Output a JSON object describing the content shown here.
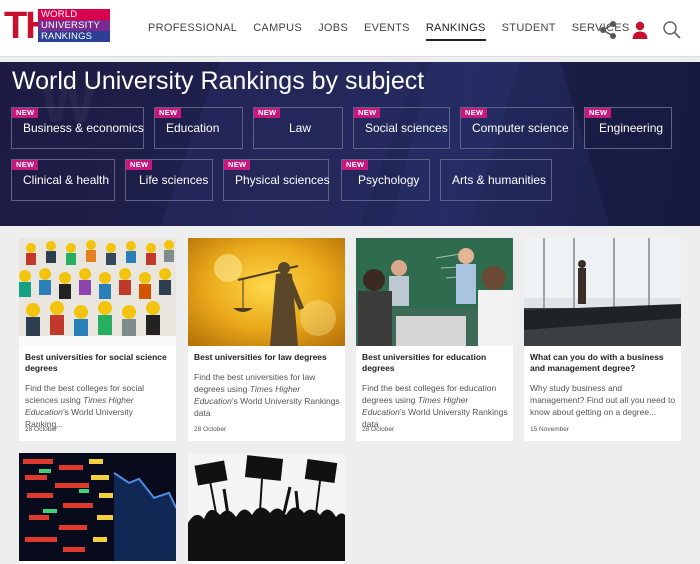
{
  "header": {
    "logo": {
      "big": "THE",
      "line1": "WORLD",
      "line2": "UNIVERSITY",
      "line3": "RANKINGS"
    },
    "nav": [
      "PROFESSIONAL",
      "CAMPUS",
      "JOBS",
      "EVENTS",
      "RANKINGS",
      "STUDENT",
      "SERVICES"
    ],
    "active_nav": "RANKINGS",
    "icons": [
      "share-icon",
      "user-icon",
      "search-icon"
    ]
  },
  "banner": {
    "title": "World University Rankings by subject",
    "badge": "NEW",
    "subjects": [
      {
        "label": "Business & economics",
        "new": true
      },
      {
        "label": "Education",
        "new": true
      },
      {
        "label": "Law",
        "new": true
      },
      {
        "label": "Social sciences",
        "new": true
      },
      {
        "label": "Computer science",
        "new": true
      },
      {
        "label": "Engineering",
        "new": true
      },
      {
        "label": "Clinical & health",
        "new": true
      },
      {
        "label": "Life sciences",
        "new": true
      },
      {
        "label": "Physical sciences",
        "new": true
      },
      {
        "label": "Psychology",
        "new": true
      },
      {
        "label": "Arts & humanities",
        "new": false
      }
    ]
  },
  "cards": [
    {
      "title": "Best universities for social science degrees",
      "desc_pre": "Find the best colleges for social sciences using ",
      "desc_em": "Times Higher Education",
      "desc_post": "’s World University Ranking...",
      "date": "28 October",
      "image": "lego-figures-image"
    },
    {
      "title": "Best universities for law degrees",
      "desc_pre": "Find the best universities for law degrees using ",
      "desc_em": "Times Higher Education",
      "desc_post": "’s World University Rankings data",
      "date": "28 October",
      "image": "lady-justice-image"
    },
    {
      "title": "Best universities for education degrees",
      "desc_pre": "Find the best colleges for education degrees using ",
      "desc_em": "Times Higher Education",
      "desc_post": "’s World University Rankings data",
      "date": "28 October",
      "image": "classroom-image"
    },
    {
      "title": "What can you do with a business and management degree?",
      "desc_pre": "Why study business and management? Find out all you need to know about getting on a degree...",
      "desc_em": "",
      "desc_post": "",
      "date": "15 November",
      "image": "boardroom-image"
    },
    {
      "image": "stock-ticker-image"
    },
    {
      "image": "protest-crowd-image"
    }
  ],
  "colors": {
    "brand_red": "#c8102e",
    "badge_magenta": "#c8187d",
    "banner_navy": "#1f2251",
    "user_icon_red": "#c8102e"
  }
}
